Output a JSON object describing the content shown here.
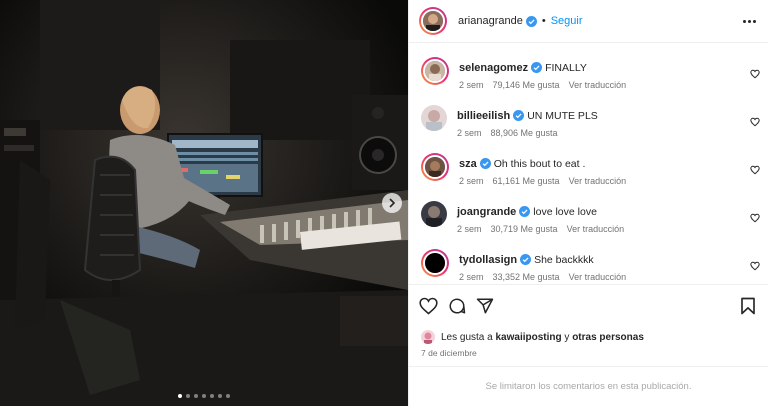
{
  "post": {
    "author": "arianagrande",
    "follow_label": "Seguir",
    "separator": "•"
  },
  "carousel": {
    "slide_count": 7,
    "active_index": 0
  },
  "comments": [
    {
      "user": "selenagomez",
      "text": "FINALLY",
      "age": "2 sem",
      "likes": "79,146 Me gusta",
      "translate": "Ver traducción",
      "avatar_color": "#c9b7a6"
    },
    {
      "user": "billieeilish",
      "text": "UN MUTE PLS",
      "age": "2 sem",
      "likes": "88,906 Me gusta",
      "translate": "",
      "avatar_color": "#d8c8c6"
    },
    {
      "user": "sza",
      "text": "Oh this bout to eat .",
      "age": "2 sem",
      "likes": "61,161 Me gusta",
      "translate": "Ver traducción",
      "avatar_color": "#6b5443"
    },
    {
      "user": "joangrande",
      "text": "love love love",
      "age": "2 sem",
      "likes": "30,719 Me gusta",
      "translate": "Ver traducción",
      "avatar_color": "#3a3a44"
    },
    {
      "user": "tydollasign",
      "text": "She backkkk",
      "age": "2 sem",
      "likes": "33,352 Me gusta",
      "translate": "Ver traducción",
      "avatar_color": "#000000"
    }
  ],
  "likes_summary": {
    "prefix": "Les gusta a",
    "user": "kawaiiposting",
    "middle": "y",
    "suffix": "otras personas"
  },
  "date": "7 de diciembre",
  "comments_limited": "Se limitaron los comentarios en esta publicación.",
  "colors": {
    "accent_blue": "#0095f6",
    "verified_blue": "#3897f0",
    "story_ring_start": "#f9a13a",
    "story_ring_end": "#b5379c"
  }
}
